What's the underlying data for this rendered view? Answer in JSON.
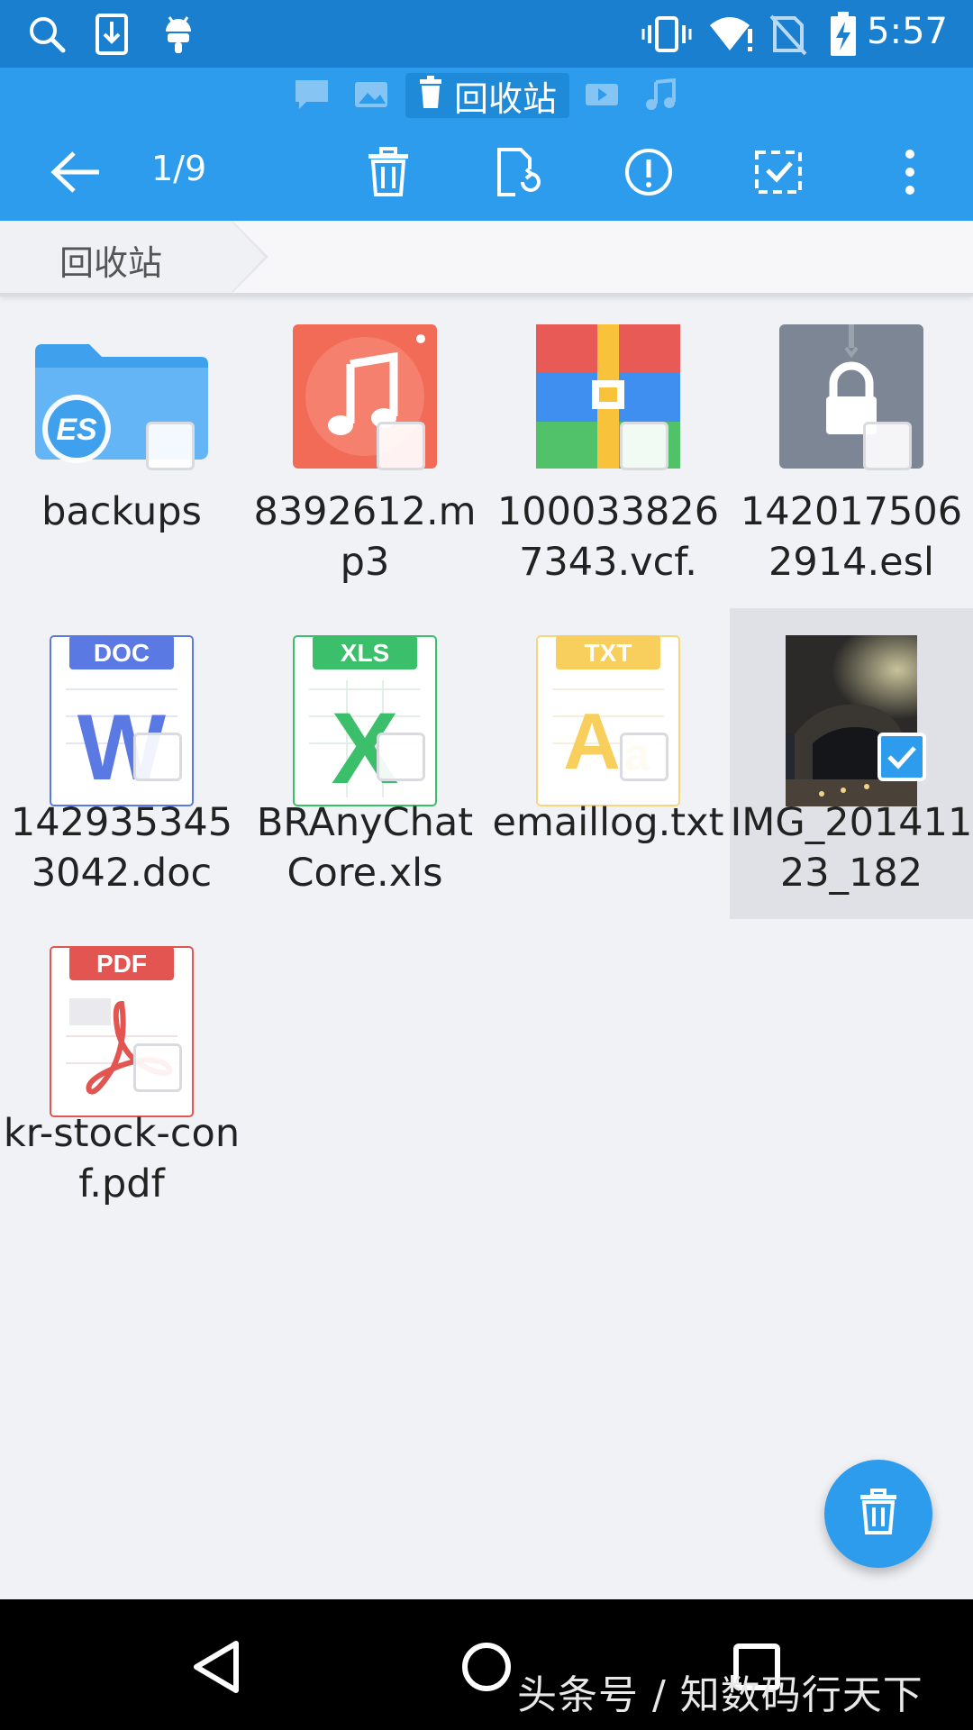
{
  "status_bar": {
    "time": "5:57",
    "left_icons": [
      "search-icon",
      "download-icon",
      "android-icon"
    ],
    "right_icons": [
      "vibrate-icon",
      "wifi-icon",
      "no-sim-icon",
      "battery-charging-icon"
    ]
  },
  "window_tabs": {
    "current_label": "回收站",
    "other_icons": [
      "sms-icon",
      "image-icon",
      "video-icon",
      "music-icon"
    ]
  },
  "toolbar": {
    "selection_count": "1/9",
    "actions": [
      "back-arrow-icon",
      "delete-icon",
      "restore-icon",
      "info-icon",
      "select-all-icon",
      "more-vert-icon"
    ]
  },
  "breadcrumb": {
    "label": "回收站"
  },
  "files": [
    {
      "name": "backups",
      "type": "folder",
      "selected": false
    },
    {
      "name": "8392612.mp3",
      "type": "audio",
      "selected": false
    },
    {
      "name": "1000338267343.vcf.",
      "type": "archive",
      "selected": false
    },
    {
      "name": "1420175062914.esl",
      "type": "locked",
      "selected": false
    },
    {
      "name": "1429353453042.doc",
      "type": "doc",
      "badge": "DOC",
      "selected": false
    },
    {
      "name": "BRAnyChatCore.xls",
      "type": "xls",
      "badge": "XLS",
      "selected": false
    },
    {
      "name": "emaillog.txt",
      "type": "txt",
      "badge": "TXT",
      "selected": false
    },
    {
      "name": "IMG_20141123_182",
      "type": "image",
      "selected": true
    },
    {
      "name": "kr-stock-conf.pdf",
      "type": "pdf",
      "badge": "PDF",
      "selected": false
    }
  ],
  "fab": {
    "icon": "delete-icon"
  },
  "nav_bar": {
    "watermark": "头条号 / 知数码行天下"
  },
  "colors": {
    "accent": "#2e9cec",
    "status_bar": "#1a7fcf"
  }
}
